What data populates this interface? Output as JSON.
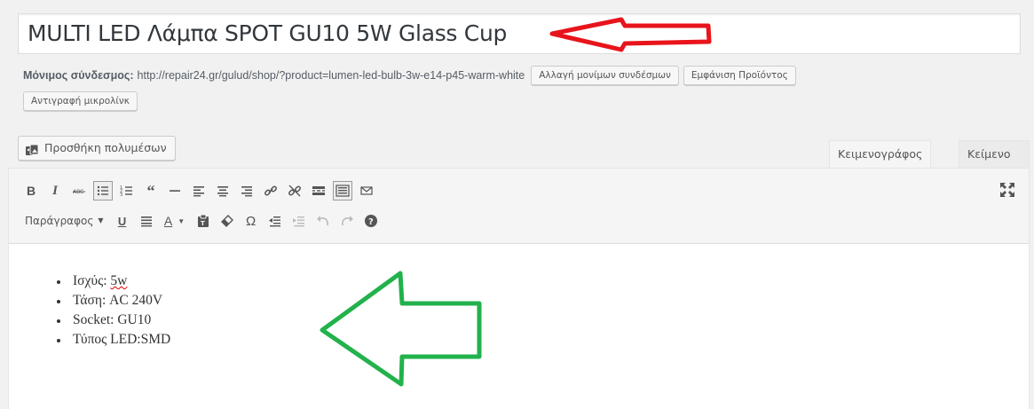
{
  "title": "MULTI LED Λάμπα SPOT GU10 5W Glass Cup",
  "permalink": {
    "label": "Μόνιμος σύνδεσμος:",
    "url": "http://repair24.gr/gulud/shop/?product=lumen-led-bulb-3w-e14-p45-warm-white",
    "change_button": "Αλλαγή μονίμων συνδέσμων",
    "view_button": "Εμφάνιση Προϊόντος",
    "shortlink_button": "Αντιγραφή μικρολίνκ"
  },
  "media_button": "Προσθήκη πολυμέσων",
  "tabs": {
    "visual": "Κειμενογράφος",
    "text": "Κείμενο"
  },
  "toolbar": {
    "format_select": "Παράγραφος"
  },
  "content": {
    "items": [
      {
        "prefix": "Ισχύς: ",
        "value": "5w"
      },
      {
        "text": "Τάση: AC 240V"
      },
      {
        "text": "Socket: GU10"
      },
      {
        "text": "Τύπος LED:SMD"
      }
    ]
  },
  "annotations": {
    "red_arrow_color": "#e8141b",
    "green_arrow_color": "#22b24c"
  }
}
